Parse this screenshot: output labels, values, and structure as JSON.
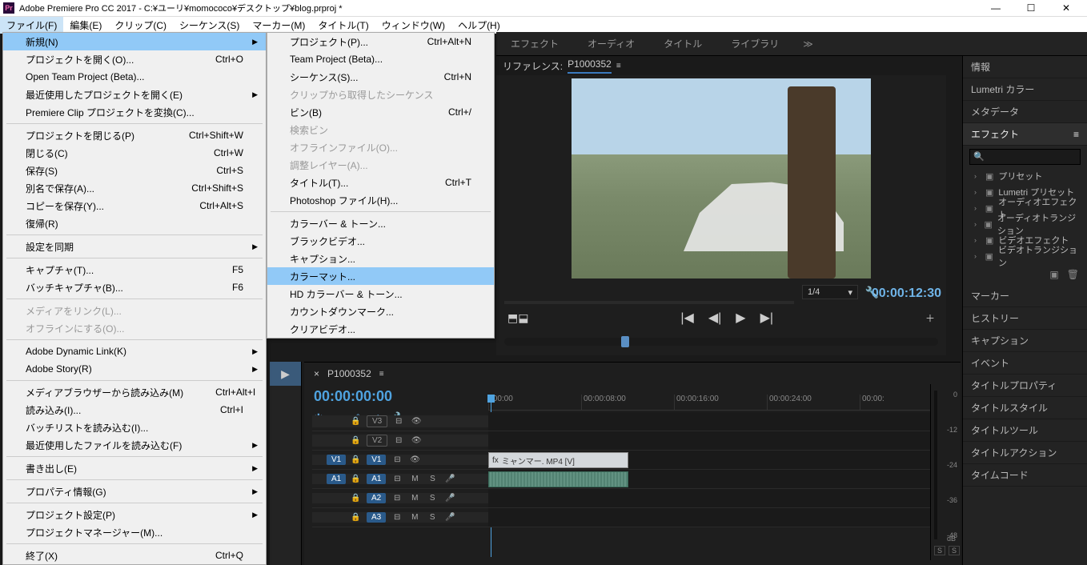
{
  "titlebar": {
    "app_icon": "Pr",
    "title": "Adobe Premiere Pro CC 2017 - C:¥ユーリ¥momococo¥デスクトップ¥blog.prproj *"
  },
  "menubar": {
    "items": [
      "ファイル(F)",
      "編集(E)",
      "クリップ(C)",
      "シーケンス(S)",
      "マーカー(M)",
      "タイトル(T)",
      "ウィンドウ(W)",
      "ヘルプ(H)"
    ]
  },
  "file_menu": {
    "items": [
      {
        "label": "新規(N)",
        "shortcut": "",
        "arrow": true,
        "highlighted": true
      },
      {
        "label": "プロジェクトを開く(O)...",
        "shortcut": "Ctrl+O"
      },
      {
        "label": "Open Team Project (Beta)...",
        "shortcut": ""
      },
      {
        "label": "最近使用したプロジェクトを開く(E)",
        "shortcut": "",
        "arrow": true
      },
      {
        "label": "Premiere Clip プロジェクトを変換(C)...",
        "shortcut": ""
      },
      {
        "sep": true
      },
      {
        "label": "プロジェクトを閉じる(P)",
        "shortcut": "Ctrl+Shift+W"
      },
      {
        "label": "閉じる(C)",
        "shortcut": "Ctrl+W"
      },
      {
        "label": "保存(S)",
        "shortcut": "Ctrl+S"
      },
      {
        "label": "別名で保存(A)...",
        "shortcut": "Ctrl+Shift+S"
      },
      {
        "label": "コピーを保存(Y)...",
        "shortcut": "Ctrl+Alt+S"
      },
      {
        "label": "復帰(R)",
        "shortcut": ""
      },
      {
        "sep": true
      },
      {
        "label": "設定を同期",
        "shortcut": "",
        "arrow": true
      },
      {
        "sep": true
      },
      {
        "label": "キャプチャ(T)...",
        "shortcut": "F5"
      },
      {
        "label": "バッチキャプチャ(B)...",
        "shortcut": "F6"
      },
      {
        "sep": true
      },
      {
        "label": "メディアをリンク(L)...",
        "shortcut": "",
        "disabled": true
      },
      {
        "label": "オフラインにする(O)...",
        "shortcut": "",
        "disabled": true
      },
      {
        "sep": true
      },
      {
        "label": "Adobe Dynamic Link(K)",
        "shortcut": "",
        "arrow": true
      },
      {
        "label": "Adobe Story(R)",
        "shortcut": "",
        "arrow": true
      },
      {
        "sep": true
      },
      {
        "label": "メディアブラウザーから読み込み(M)",
        "shortcut": "Ctrl+Alt+I"
      },
      {
        "label": "読み込み(I)...",
        "shortcut": "Ctrl+I"
      },
      {
        "label": "バッチリストを読み込む(I)...",
        "shortcut": ""
      },
      {
        "label": "最近使用したファイルを読み込む(F)",
        "shortcut": "",
        "arrow": true
      },
      {
        "sep": true
      },
      {
        "label": "書き出し(E)",
        "shortcut": "",
        "arrow": true
      },
      {
        "sep": true
      },
      {
        "label": "プロパティ情報(G)",
        "shortcut": "",
        "arrow": true
      },
      {
        "sep": true
      },
      {
        "label": "プロジェクト設定(P)",
        "shortcut": "",
        "arrow": true
      },
      {
        "label": "プロジェクトマネージャー(M)...",
        "shortcut": ""
      },
      {
        "sep": true
      },
      {
        "label": "終了(X)",
        "shortcut": "Ctrl+Q"
      }
    ]
  },
  "new_submenu": {
    "items": [
      {
        "label": "プロジェクト(P)...",
        "shortcut": "Ctrl+Alt+N"
      },
      {
        "label": "Team Project (Beta)...",
        "shortcut": ""
      },
      {
        "label": "シーケンス(S)...",
        "shortcut": "Ctrl+N"
      },
      {
        "label": "クリップから取得したシーケンス",
        "shortcut": "",
        "disabled": true
      },
      {
        "label": "ビン(B)",
        "shortcut": "Ctrl+/"
      },
      {
        "label": "検索ビン",
        "shortcut": "",
        "disabled": true
      },
      {
        "label": "オフラインファイル(O)...",
        "shortcut": "",
        "disabled": true
      },
      {
        "label": "調整レイヤー(A)...",
        "shortcut": "",
        "disabled": true
      },
      {
        "label": "タイトル(T)...",
        "shortcut": "Ctrl+T"
      },
      {
        "label": "Photoshop ファイル(H)...",
        "shortcut": ""
      },
      {
        "sep": true
      },
      {
        "label": "カラーバー & トーン...",
        "shortcut": ""
      },
      {
        "label": "ブラックビデオ...",
        "shortcut": ""
      },
      {
        "label": "キャプション...",
        "shortcut": ""
      },
      {
        "label": "カラーマット...",
        "shortcut": "",
        "highlighted": true
      },
      {
        "label": "HD カラーバー & トーン...",
        "shortcut": ""
      },
      {
        "label": "カウントダウンマーク...",
        "shortcut": ""
      },
      {
        "label": "クリアビデオ...",
        "shortcut": ""
      }
    ]
  },
  "workspace_tabs": [
    "エフェクト",
    "オーディオ",
    "タイトル",
    "ライブラリ"
  ],
  "workspace_more": "≫",
  "program": {
    "reference_label": "リファレンス:",
    "sequence_name": "P1000352",
    "zoom": "1/4",
    "timecode": "00:00:12:30"
  },
  "right_panels": {
    "rows": [
      "情報",
      "Lumetri カラー",
      "メタデータ"
    ],
    "effects_label": "エフェクト",
    "search_placeholder": "",
    "folders": [
      "プリセット",
      "Lumetri プリセット",
      "オーディオエフェクト",
      "オーディオトランジション",
      "ビデオエフェクト",
      "ビデオトランジション"
    ],
    "rows2": [
      "マーカー",
      "ヒストリー",
      "キャプション",
      "イベント",
      "タイトルプロパティ",
      "タイトルスタイル",
      "タイトルツール",
      "タイトルアクション",
      "タイムコード"
    ]
  },
  "timeline": {
    "sequence_name": "P1000352",
    "timecode": "00:00:00:00",
    "ruler": [
      ":00:00",
      "00:00:08:00",
      "00:00:16:00",
      "00:00:24:00",
      "00:00:"
    ],
    "tracks": [
      {
        "type": "v",
        "tag": "V3",
        "tag_style": "outline"
      },
      {
        "type": "v",
        "tag": "V2",
        "tag_style": "outline"
      },
      {
        "type": "v",
        "tag": "V1",
        "tag_style": "solid",
        "source": "V1",
        "clip": "ミャンマー. MP4 [V]"
      },
      {
        "type": "a",
        "tag": "A1",
        "tag_style": "solid",
        "source": "A1",
        "clip": true
      },
      {
        "type": "a",
        "tag": "A2",
        "tag_style": "solid"
      },
      {
        "type": "a",
        "tag": "A3",
        "tag_style": "solid"
      }
    ]
  },
  "audio_meter": {
    "ticks": [
      "0",
      "-12",
      "-24",
      "-36",
      "-48"
    ],
    "db_label": "dB",
    "solo": [
      "S",
      "S"
    ]
  }
}
